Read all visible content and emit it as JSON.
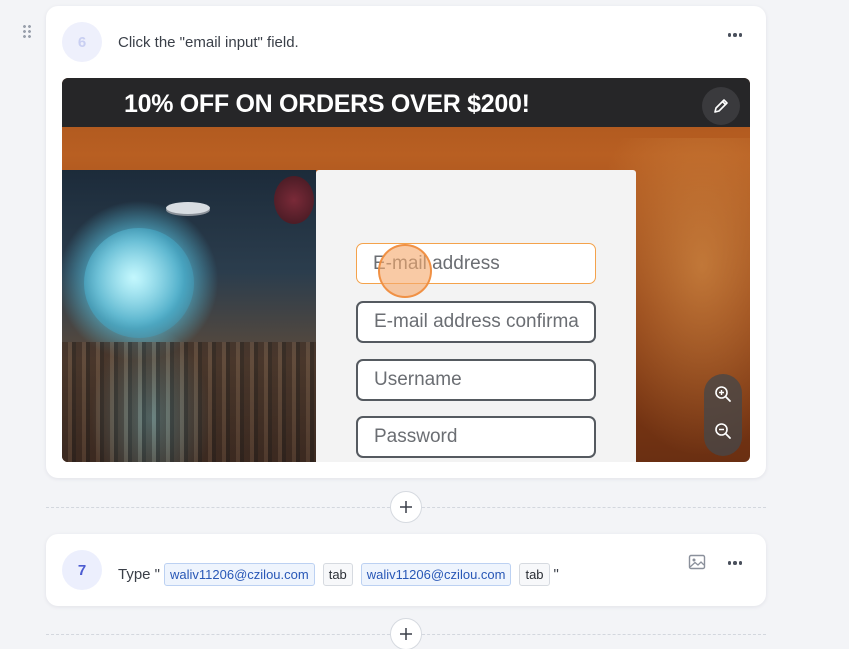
{
  "steps": [
    {
      "number": "6",
      "instruction": "Click the \"email input\" field.",
      "screenshot": {
        "banner": "10% OFF ON ORDERS OVER $200!",
        "fields": [
          "E-mail address",
          "E-mail address confirma",
          "Username",
          "Password"
        ]
      }
    },
    {
      "number": "7",
      "type_prefix": "Type \"",
      "type_suffix": "\"",
      "tokens": [
        {
          "text": "waliv11206@czilou.com",
          "kind": "value"
        },
        {
          "text": "tab",
          "kind": "key"
        },
        {
          "text": "waliv11206@czilou.com",
          "kind": "value"
        },
        {
          "text": "tab",
          "kind": "key"
        }
      ]
    }
  ],
  "icons": {
    "more": "more-horizontal-icon",
    "edit": "pencil-icon",
    "zoom_in": "zoom-in-icon",
    "zoom_out": "zoom-out-icon",
    "add": "plus-icon",
    "image": "image-icon",
    "drag": "drag-handle-icon"
  },
  "colors": {
    "accent": "#4b5bd1",
    "highlight": "#f4a24b",
    "chip_value_bg": "#eef4fd"
  }
}
